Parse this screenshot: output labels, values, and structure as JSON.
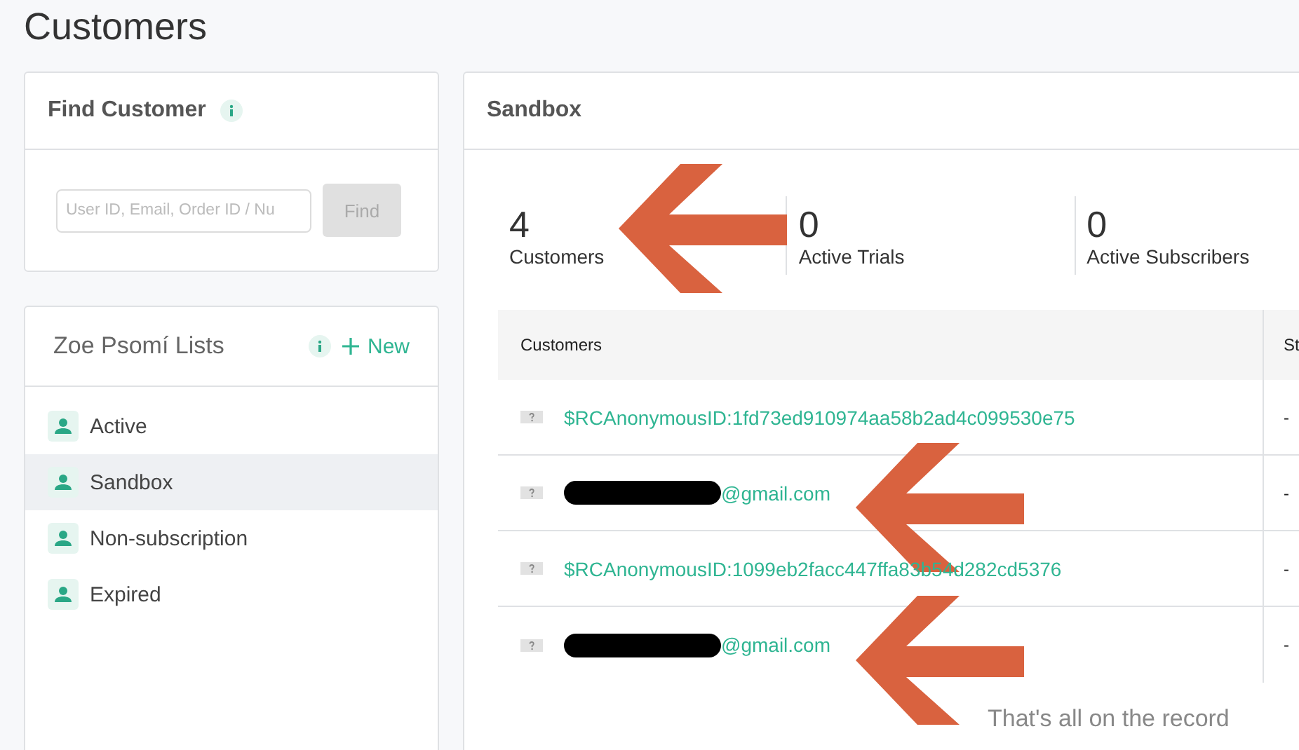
{
  "page_title": "Customers",
  "find_customer": {
    "title": "Find Customer",
    "placeholder": "User ID, Email, Order ID / Nu",
    "button": "Find",
    "button_disabled": true
  },
  "lists": {
    "title": "Zoe Psomí Lists",
    "new_label": "New",
    "items": [
      {
        "label": "Active",
        "selected": false
      },
      {
        "label": "Sandbox",
        "selected": true
      },
      {
        "label": "Non-subscription",
        "selected": false
      },
      {
        "label": "Expired",
        "selected": false
      }
    ]
  },
  "panel": {
    "title": "Sandbox",
    "stats": [
      {
        "value": "4",
        "label": "Customers",
        "annotated": true
      },
      {
        "value": "0",
        "label": "Active Trials",
        "annotated": false
      },
      {
        "value": "0",
        "label": "Active Subscribers",
        "annotated": false
      }
    ],
    "table": {
      "columns": [
        "Customers",
        "St"
      ],
      "rows": [
        {
          "customer": "$RCAnonymousID:1fd73ed910974aa58b2ad4c099530e75",
          "column_2": "-",
          "redacted": false,
          "annotated": false
        },
        {
          "customer": "@gmail.com",
          "column_2": "-",
          "redacted": true,
          "annotated": true
        },
        {
          "customer": "$RCAnonymousID:1099eb2facc447ffa83b54d282cd5376",
          "column_2": "-",
          "redacted": false,
          "annotated": false
        },
        {
          "customer": "@gmail.com",
          "column_2": "-",
          "redacted": true,
          "annotated": true
        }
      ]
    },
    "footer": "That's all on the record"
  }
}
